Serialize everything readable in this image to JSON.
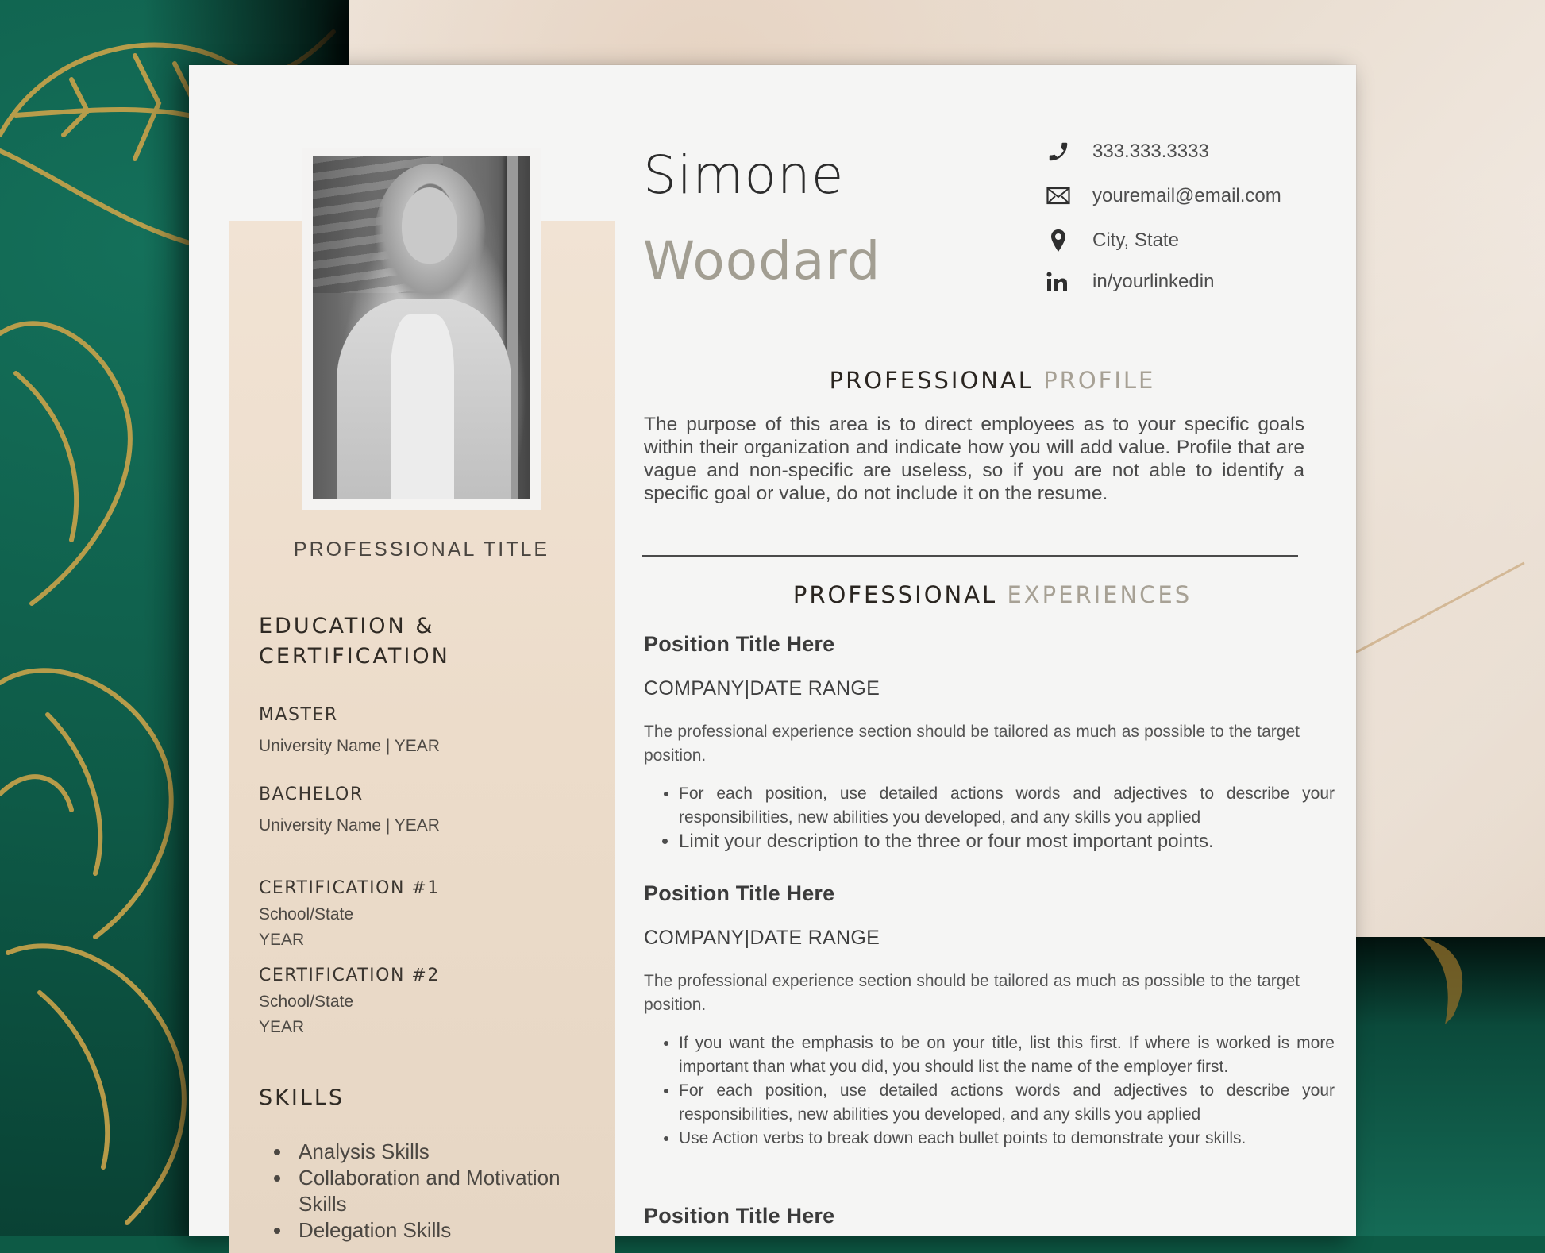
{
  "colors": {
    "background_green": "#0d5a45",
    "gold_accent": "#c9a34a",
    "sidebar_beige": "#ecdcca",
    "heading_dark": "#2a2520",
    "heading_light": "#a7a195",
    "last_name": "#a29e92"
  },
  "header": {
    "first_name": "Simone",
    "last_name": "Woodard"
  },
  "contact": [
    {
      "icon": "phone-icon",
      "text": "333.333.3333"
    },
    {
      "icon": "envelope-icon",
      "text": "youremail@email.com"
    },
    {
      "icon": "location-pin-icon",
      "text": "City, State"
    },
    {
      "icon": "linkedin-icon",
      "text": "in/yourlinkedin"
    }
  ],
  "sidebar": {
    "professional_title": "PROFESSIONAL TITLE",
    "education_heading_line1": "EDUCATION &",
    "education_heading_line2": "CERTIFICATION",
    "education": [
      {
        "degree": "MASTER",
        "detail": "University Name | YEAR"
      },
      {
        "degree": "BACHELOR",
        "detail": "University Name | YEAR"
      }
    ],
    "certifications": [
      {
        "title": "CERTIFICATION #1",
        "school": "School/State",
        "year": "YEAR"
      },
      {
        "title": "CERTIFICATION #2",
        "school": "School/State",
        "year": "YEAR"
      }
    ],
    "skills_heading": "SKILLS",
    "skills": [
      "Analysis Skills",
      "Collaboration and Motivation Skills",
      "Delegation Skills"
    ]
  },
  "profile": {
    "heading_dark": "PROFESSIONAL",
    "heading_light": "PROFILE",
    "text": "The purpose of this area is to direct employees as to your specific goals within their organization and indicate how you will add value. Profile that are vague and non-specific are useless, so if you are not able to identify a specific goal or value, do not include it on the resume."
  },
  "experience": {
    "heading_dark": "PROFESSIONAL",
    "heading_light": "EXPERIENCES",
    "positions": [
      {
        "title": "Position Title Here",
        "company": "COMPANY|DATE RANGE",
        "description": "The professional experience section should be tailored as much as possible to the target position.",
        "bullets": [
          "For each position, use detailed actions words and adjectives to describe your responsibilities, new abilities you developed, and any skills you applied",
          "Limit your description to the three or four most important points."
        ]
      },
      {
        "title": "Position Title Here",
        "company": "COMPANY|DATE RANGE",
        "description": "The professional experience section should be tailored as much as possible to the target position.",
        "bullets": [
          "If you want the emphasis to be on your title, list this first.  If where is worked is more important than what you did, you should list the name of the employer first.",
          "For each position, use detailed actions words and adjectives to describe your responsibilities, new abilities you developed, and any skills you applied",
          "Use Action verbs to break down each bullet points to demonstrate your skills."
        ]
      },
      {
        "title": "Position Title Here"
      }
    ]
  }
}
